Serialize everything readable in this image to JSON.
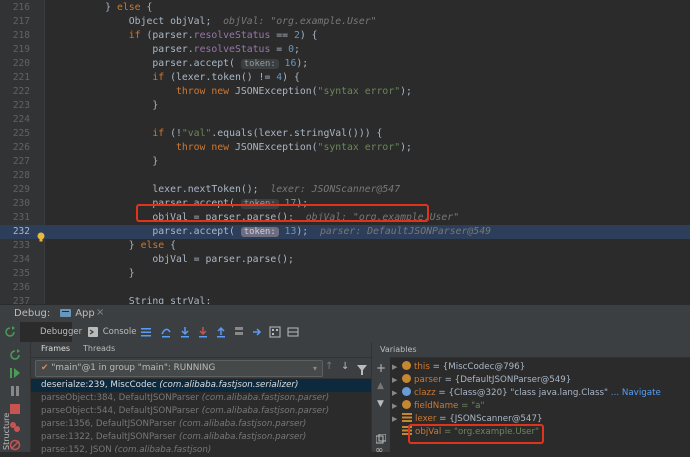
{
  "editor": {
    "lines": [
      {
        "num": "216",
        "html": "        } <span class=\"kw\">else</span> {"
      },
      {
        "num": "217",
        "html": "            Object objVal;  <span class=\"dbg\">objVal: \"org.example.User\"</span>"
      },
      {
        "num": "218",
        "html": "            <span class=\"kw\">if</span> (parser.<span class=\"fld\">resolveStatus</span> == <span class=\"num\">2</span>) {"
      },
      {
        "num": "219",
        "html": "                parser.<span class=\"fld\">resolveStatus</span> = <span class=\"num\">0</span>;"
      },
      {
        "num": "220",
        "html": "                parser.accept( <span class=\"hint\">token:</span> <span class=\"num\">16</span>);"
      },
      {
        "num": "221",
        "html": "                <span class=\"kw\">if</span> (lexer.token() != <span class=\"num\">4</span>) {"
      },
      {
        "num": "222",
        "html": "                    <span class=\"kw\">throw new</span> JSONException(<span class=\"str\">\"syntax error\"</span>);"
      },
      {
        "num": "223",
        "html": "                }"
      },
      {
        "num": "224",
        "html": ""
      },
      {
        "num": "225",
        "html": "                <span class=\"kw\">if</span> (!<span class=\"str\">\"val\"</span>.equals(lexer.stringVal())) {"
      },
      {
        "num": "226",
        "html": "                    <span class=\"kw\">throw new</span> JSONException(<span class=\"str\">\"syntax error\"</span>);"
      },
      {
        "num": "227",
        "html": "                }"
      },
      {
        "num": "228",
        "html": ""
      },
      {
        "num": "229",
        "html": "                lexer.nextToken();  <span class=\"dbg\">lexer: JSONScanner@547</span>"
      },
      {
        "num": "230",
        "html": "                parser.accept( <span class=\"hint\">token:</span> <span class=\"num\">17</span>);"
      },
      {
        "num": "231",
        "html": "                objVal = parser.parse();  <span class=\"dbg\">objVal: \"org.example.User\"</span>"
      },
      {
        "num": "232",
        "html": "                parser.accept( <span class=\"hint-sel\">token:</span> <span class=\"num\">13</span>);  <span class=\"dbg\">parser: DefaultJSONParser@549</span>"
      },
      {
        "num": "233",
        "html": "            } <span class=\"kw\">else</span> {"
      },
      {
        "num": "234",
        "html": "                objVal = parser.parse();"
      },
      {
        "num": "235",
        "html": "            }"
      },
      {
        "num": "236",
        "html": ""
      },
      {
        "num": "237",
        "html": "            String strVal;"
      },
      {
        "num": "238",
        "html": ""
      }
    ]
  },
  "debug_bar": {
    "label": "Debug:",
    "app_tab": "App"
  },
  "toolbar": {
    "debugger_tab": "Debugger",
    "console_tab": "Console"
  },
  "frames": {
    "frames_tab": "Frames",
    "threads_tab": "Threads",
    "thread_selected": "\"main\"@1 in group \"main\": RUNNING",
    "items": [
      {
        "method": "deserialze:239, MiscCodec",
        "pkg": "(com.alibaba.fastjson.serializer)"
      },
      {
        "method": "parseObject:384, DefaultJSONParser",
        "pkg": "(com.alibaba.fastjson.parser)"
      },
      {
        "method": "parseObject:544, DefaultJSONParser",
        "pkg": "(com.alibaba.fastjson.parser)"
      },
      {
        "method": "parse:1356, DefaultJSONParser",
        "pkg": "(com.alibaba.fastjson.parser)"
      },
      {
        "method": "parse:1322, DefaultJSONParser",
        "pkg": "(com.alibaba.fastjson.parser)"
      },
      {
        "method": "parse:152, JSON",
        "pkg": "(com.alibaba.fastjson)"
      }
    ]
  },
  "variables": {
    "title": "Variables",
    "items": [
      {
        "name": "this",
        "value": "= {MiscCodec@796}",
        "link": ""
      },
      {
        "name": "parser",
        "value": "= {DefaultJSONParser@549}",
        "link": ""
      },
      {
        "name": "clazz",
        "value": "= {Class@320} \"class java.lang.Class\"",
        "link": "... Navigate"
      },
      {
        "name": "fieldName",
        "value": "= \"a\"",
        "link": ""
      },
      {
        "name": "lexer",
        "value": "= {JSONScanner@547}",
        "link": ""
      },
      {
        "name": "objVal",
        "value": "= \"org.example.User\"",
        "link": ""
      }
    ]
  },
  "sidebar": {
    "structure": "Structure"
  }
}
